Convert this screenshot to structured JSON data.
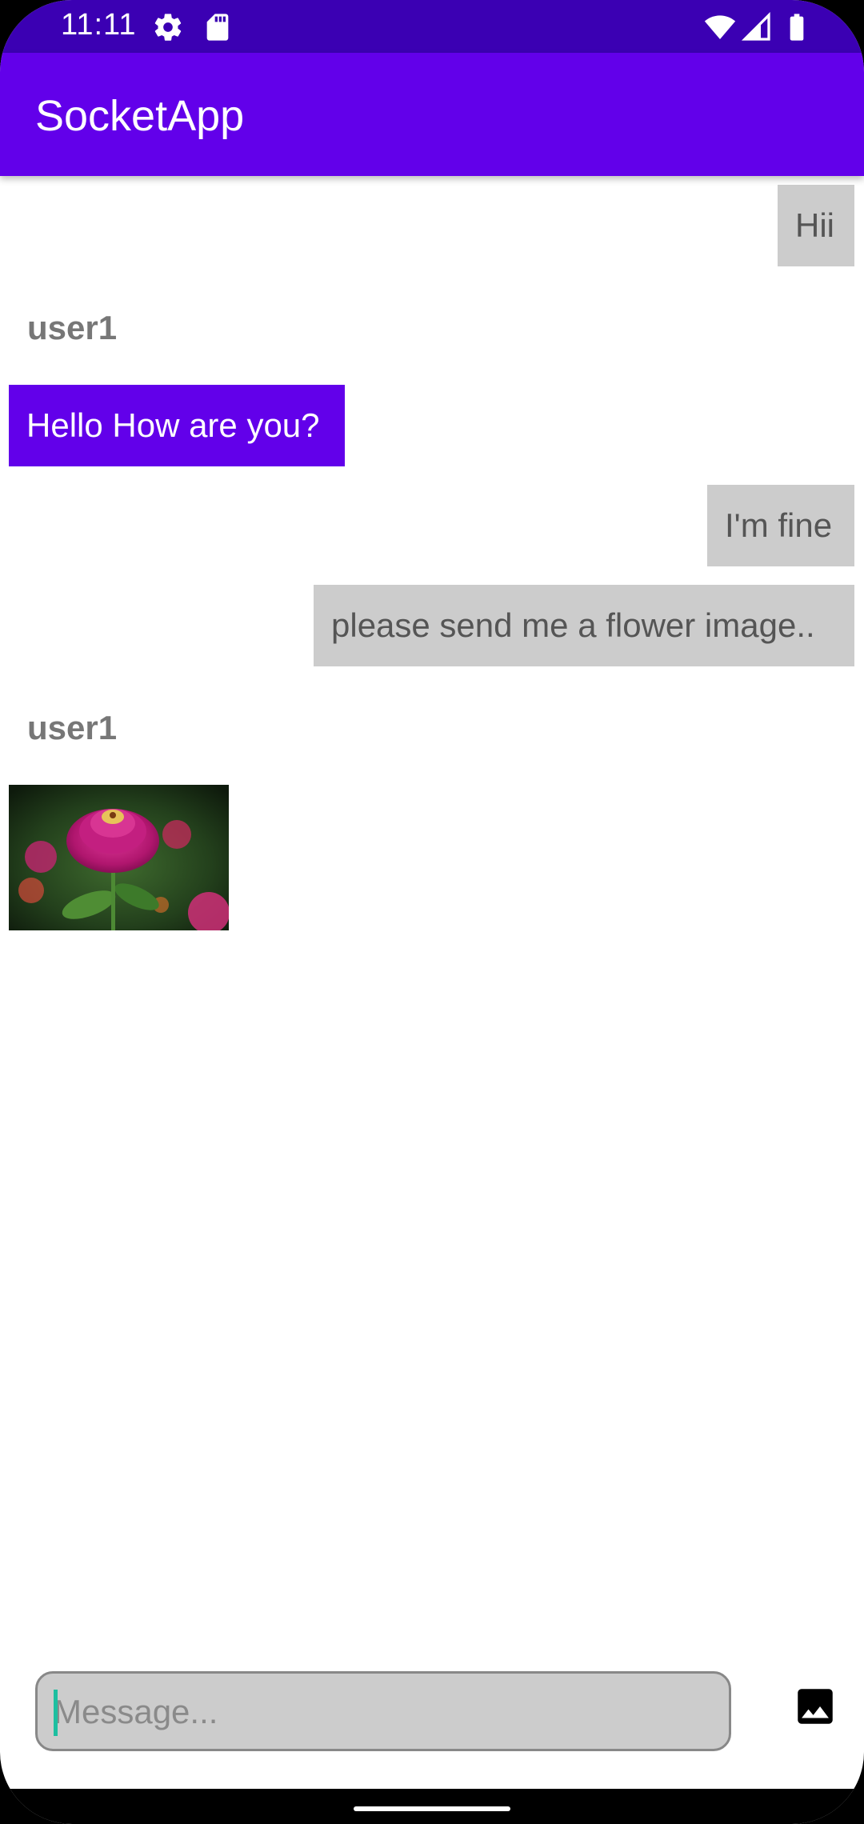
{
  "status_bar": {
    "time": "11:11",
    "icons_left": [
      "settings-icon",
      "sd-card-icon"
    ],
    "icons_right": [
      "wifi-icon",
      "signal-icon",
      "battery-icon"
    ]
  },
  "app_bar": {
    "title": "SocketApp",
    "color": "#6200ea"
  },
  "messages": [
    {
      "from": "me",
      "text": "Hii"
    },
    {
      "from": "user1",
      "sender": "user1",
      "text": "Hello How are you?"
    },
    {
      "from": "me",
      "text": "I'm fine"
    },
    {
      "from": "me",
      "text": "please send me a flower image.."
    },
    {
      "from": "user1",
      "sender": "user1",
      "type": "image",
      "image": "flower-image"
    }
  ],
  "composer": {
    "placeholder": "Message...",
    "value": "",
    "attach_icon": "image-icon"
  },
  "colors": {
    "status_bar": "#3b00b3",
    "accent": "#6200ea",
    "my_bubble": "#cccccc",
    "caret": "#1dbfa0"
  }
}
